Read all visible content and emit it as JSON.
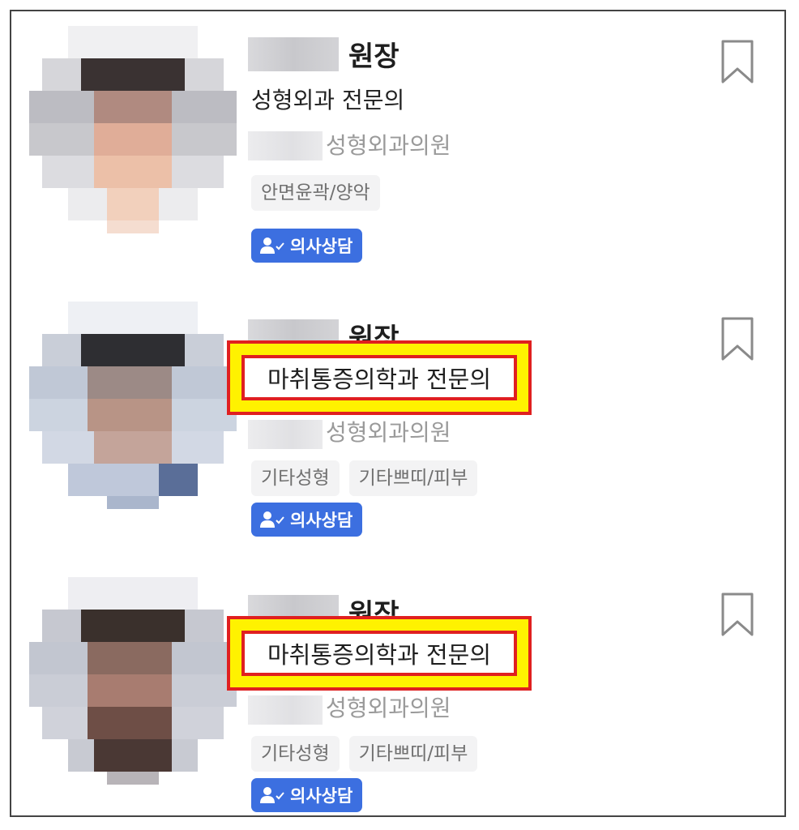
{
  "doctors": [
    {
      "title": "원장",
      "specialty": "성형외과 전문의",
      "specialty_highlighted": false,
      "clinic": "성형외과의원",
      "tags": [
        "안면윤곽/양악"
      ],
      "consult_label": "의사상담"
    },
    {
      "title": "원장",
      "specialty": "마취통증의학과 전문의",
      "specialty_highlighted": true,
      "clinic": "성형외과의원",
      "tags": [
        "기타성형",
        "기타쁘띠/피부"
      ],
      "consult_label": "의사상담"
    },
    {
      "title": "원장",
      "specialty": "마취통증의학과 전문의",
      "specialty_highlighted": true,
      "clinic": "성형외과의원",
      "tags": [
        "기타성형",
        "기타쁘띠/피부"
      ],
      "consult_label": "의사상담"
    }
  ],
  "colors": {
    "accent": "#3c6fe0",
    "highlight_fill": "#fff200",
    "highlight_border": "#e02020",
    "muted_text": "#9a9a9a",
    "tag_bg": "#f3f3f4"
  },
  "icons": {
    "bookmark": "bookmark-icon",
    "consult": "user-check-icon",
    "avatar": "pixelated-photo"
  }
}
